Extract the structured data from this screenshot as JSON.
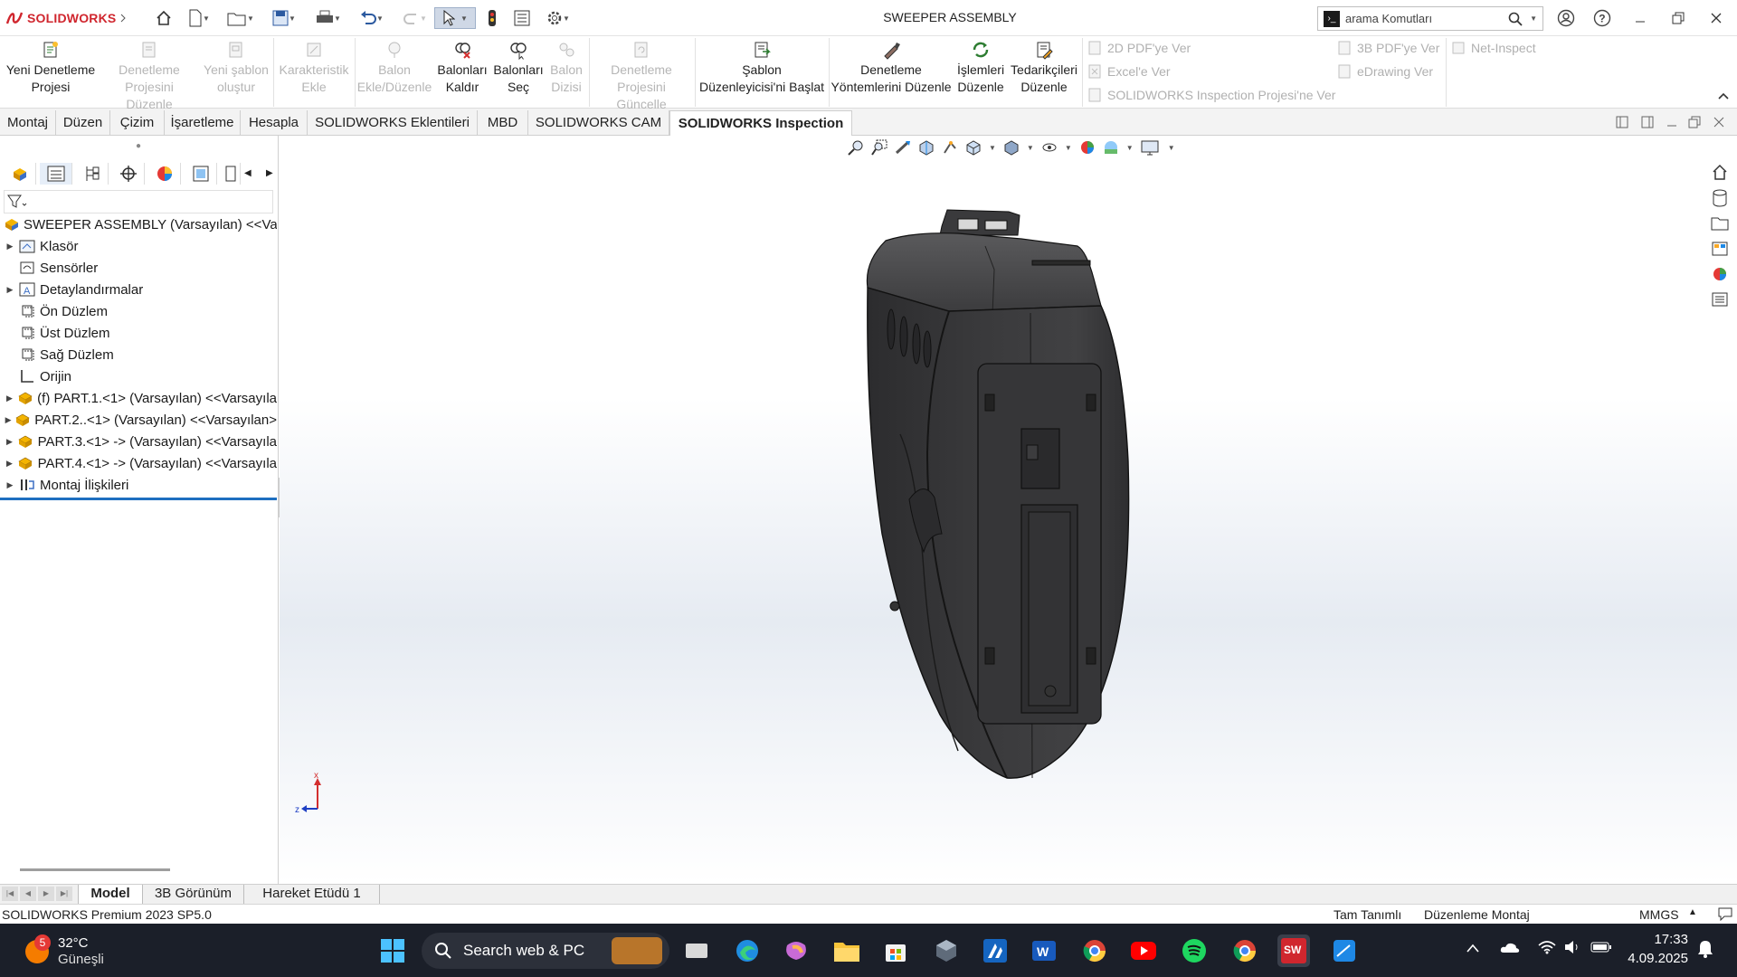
{
  "app": {
    "logo_text": "SOLIDWORKS",
    "doc_title": "SWEEPER ASSEMBLY",
    "brand_color": "#d0262e"
  },
  "search": {
    "placeholder": "arama Komutları"
  },
  "ribbon": {
    "buttons": [
      {
        "label1": "Yeni Denetleme",
        "label2": "Projesi",
        "enabled": true,
        "icon": "new-project-icon"
      },
      {
        "label1": "Denetleme",
        "label2": "Projesini Düzenle",
        "enabled": false,
        "icon": "edit-project-icon"
      },
      {
        "label1": "Yeni şablon",
        "label2": "oluştur",
        "enabled": false,
        "icon": "new-template-icon"
      },
      {
        "label1": "Karakteristik",
        "label2": "Ekle",
        "enabled": false,
        "icon": "add-characteristic-icon"
      },
      {
        "label1": "Balon",
        "label2": "Ekle/Düzenle",
        "enabled": false,
        "icon": "balloon-icon"
      },
      {
        "label1": "Balonları",
        "label2": "Kaldır",
        "enabled": true,
        "icon": "remove-balloons-icon"
      },
      {
        "label1": "Balonları",
        "label2": "Seç",
        "enabled": true,
        "icon": "select-balloons-icon"
      },
      {
        "label1": "Balon",
        "label2": "Dizisi",
        "enabled": false,
        "icon": "balloon-array-icon"
      },
      {
        "label1": "Denetleme",
        "label2": "Projesini Güncelle",
        "enabled": false,
        "icon": "update-project-icon"
      },
      {
        "label1": "Şablon",
        "label2": "Düzenleyicisi'ni Başlat",
        "enabled": true,
        "icon": "template-editor-icon"
      },
      {
        "label1": "Denetleme",
        "label2": "Yöntemlerini Düzenle",
        "enabled": true,
        "icon": "edit-methods-icon"
      },
      {
        "label1": "İşlemleri",
        "label2": "Düzenle",
        "enabled": true,
        "icon": "edit-operations-icon"
      },
      {
        "label1": "Tedarikçileri",
        "label2": "Düzenle",
        "enabled": true,
        "icon": "edit-vendors-icon"
      }
    ],
    "export": {
      "pdf2d": "2D PDF'ye Ver",
      "excel": "Excel'e Ver",
      "sw_project": "SOLIDWORKS Inspection Projesi'ne Ver",
      "pdf3d": "3B PDF'ye Ver",
      "edrawing": "eDrawing Ver",
      "net_inspect": "Net-Inspect"
    }
  },
  "tabs": [
    {
      "label": "Montaj"
    },
    {
      "label": "Düzen"
    },
    {
      "label": "Çizim"
    },
    {
      "label": "İşaretleme"
    },
    {
      "label": "Hesapla"
    },
    {
      "label": "SOLIDWORKS Eklentileri"
    },
    {
      "label": "MBD"
    },
    {
      "label": "SOLIDWORKS CAM"
    },
    {
      "label": "SOLIDWORKS Inspection"
    }
  ],
  "tree": {
    "root": "SWEEPER ASSEMBLY (Varsayılan) <<Varsa",
    "items": [
      {
        "label": "Klasör",
        "expandable": true,
        "icon": "folder-icon"
      },
      {
        "label": "Sensörler",
        "expandable": false,
        "icon": "sensor-icon"
      },
      {
        "label": "Detaylandırmalar",
        "expandable": true,
        "icon": "annotations-icon"
      },
      {
        "label": "Ön Düzlem",
        "expandable": false,
        "icon": "plane-icon"
      },
      {
        "label": "Üst Düzlem",
        "expandable": false,
        "icon": "plane-icon"
      },
      {
        "label": "Sağ Düzlem",
        "expandable": false,
        "icon": "plane-icon"
      },
      {
        "label": "Orijin",
        "expandable": false,
        "icon": "origin-icon"
      },
      {
        "label": "(f) PART.1.<1> (Varsayılan) <<Varsayıla",
        "expandable": true,
        "icon": "part-icon"
      },
      {
        "label": "PART.2..<1> (Varsayılan) <<Varsayılan>",
        "expandable": true,
        "icon": "part-icon"
      },
      {
        "label": "PART.3.<1> -> (Varsayılan) <<Varsayıla",
        "expandable": true,
        "icon": "part-icon"
      },
      {
        "label": "PART.4.<1> -> (Varsayılan) <<Varsayıla",
        "expandable": true,
        "icon": "part-icon"
      },
      {
        "label": "Montaj İlişkileri",
        "expandable": true,
        "icon": "mates-icon"
      }
    ]
  },
  "bottom_tabs": [
    {
      "label": "Model"
    },
    {
      "label": "3B Görünüm"
    },
    {
      "label": "Hareket Etüdü 1"
    }
  ],
  "status": {
    "version": "SOLIDWORKS Premium 2023 SP5.0",
    "defined": "Tam Tanımlı",
    "mode": "Düzenleme Montaj",
    "units": "MMGS"
  },
  "taskbar": {
    "weather_temp": "32°C",
    "weather_desc": "Güneşli",
    "weather_badge": "5",
    "search_label": "Search web & PC",
    "time": "17:33",
    "date": "4.09.2025"
  },
  "triad": {
    "x": "x",
    "z": "z"
  }
}
